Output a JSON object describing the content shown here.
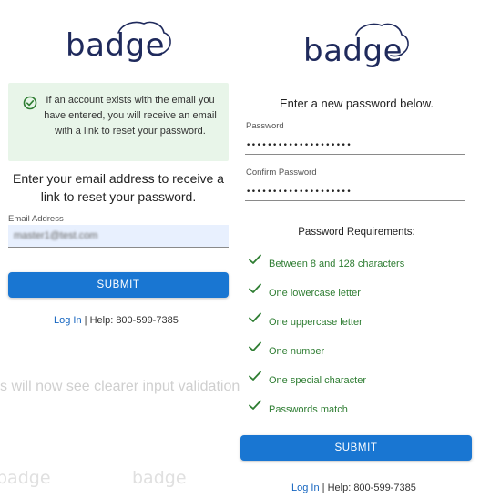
{
  "left_panel": {
    "logo_text": "badge",
    "banner": {
      "text": "If an account exists with the email you have entered, you will receive an email with a link to reset your password.",
      "color": "#e8f5e9"
    },
    "instructions": "Enter your email address to receive a link to reset your password.",
    "email": {
      "label": "Email Address",
      "value": "master1@test.com"
    },
    "submit_label": "SUBMIT",
    "footer": {
      "login_link": "Log In",
      "separator": "|",
      "help_text": "Help: 800-599-7385"
    }
  },
  "background": {
    "caption_fragment": "s will now see clearer input validation",
    "ghost_logos": [
      "badge",
      "badge"
    ]
  },
  "right_panel": {
    "logo_text": "badge",
    "subtitle": "Enter a new password below.",
    "password": {
      "label": "Password",
      "value": "••••••••••••••••••••"
    },
    "confirm_password": {
      "label": "Confirm Password",
      "value": "••••••••••••••••••••"
    },
    "requirements": {
      "title": "Password Requirements:",
      "items": [
        "Between 8 and 128 characters",
        "One lowercase letter",
        "One uppercase letter",
        "One number",
        "One special character",
        "Passwords match"
      ]
    },
    "submit_label": "SUBMIT",
    "footer": {
      "login_link": "Log In",
      "separator": "|",
      "help_text": "Help: 800-599-7385"
    }
  },
  "colors": {
    "brand_navy": "#1f2a5c",
    "primary_button": "#1976d2",
    "success_green": "#2e7d32",
    "link_blue": "#1565c0",
    "input_autofill": "#e8f0fe"
  }
}
